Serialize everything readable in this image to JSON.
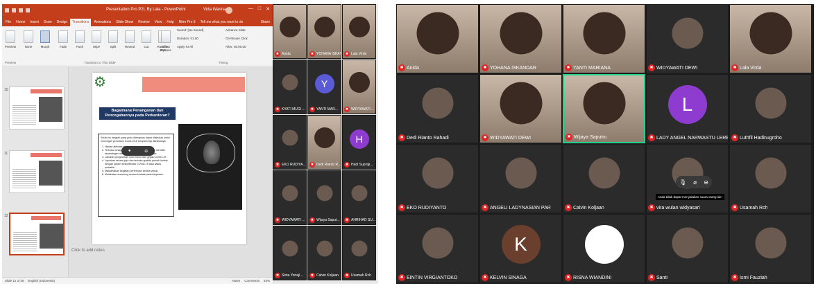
{
  "ppt": {
    "title": "Presentation Pro P2L By Lala - PowerPoint",
    "user": "Vida Wanna",
    "window_buttons": [
      "—",
      "□",
      "✕"
    ],
    "tabs": [
      "File",
      "Home",
      "Insert",
      "Draw",
      "Design",
      "Transitions",
      "Animations",
      "Slide Show",
      "Review",
      "View",
      "Help",
      "Nitro Pro 9",
      "Tell me what you want to do"
    ],
    "active_tab": "Transitions",
    "share": "Share",
    "ribbon_buttons": [
      "Preview",
      "None",
      "Morph",
      "Fade",
      "Push",
      "Wipe",
      "Split",
      "Reveal",
      "Cut",
      "Random Bars",
      "Effect Options"
    ],
    "timing": {
      "sound": "Sound: [No Sound]",
      "duration": "Duration: 01.00",
      "apply": "Apply To All",
      "advance": "Advance Slide",
      "on_click": "On Mouse Click",
      "after": "After: 00:00.00"
    },
    "groups": {
      "preview": "Preview",
      "transition": "Transition to This Slide",
      "timing": "Timing"
    },
    "slide_numbers": [
      "10",
      "11",
      "12"
    ],
    "slide": {
      "title": "Bagaimana Penanganan dan Pencegahannya pada Perkantoran?",
      "intro": "Selain itu langkah yang perlu diterapkan dapat dilakukan untuk mencegah penularan Covid-19 di tempat kerja diantaranya:",
      "list": [
        "Hindari aktivitas makan bersama.",
        "Terbuka melapor kepada pihak kantor apabila memiliki kepentingan melakukan perjalanan keluar kota.",
        "Lakukan pengecekan suhu tubuh dan gejala COVID-19.",
        "Laporkan secara jujur dan terbuka apabila pernah kontak dengan pasien terkonfirmasi COVID-19 atau kasus probable.",
        "Maksimalkan kegiatan pertemuan secara virtual.",
        "Melakukan screening secara berkala pada karyawan."
      ]
    },
    "notes": "Click to add notes",
    "status": {
      "slide": "Slide 12 of 26",
      "language": "English (Indonesia)",
      "notes": "Notes",
      "comments": "Comments",
      "zoom": "53%"
    }
  },
  "left_tiles": [
    {
      "name": "Anida",
      "avatar": "",
      "color": "",
      "video": true
    },
    {
      "name": "YOHANA ISKANDAR",
      "avatar": "",
      "color": "",
      "video": true
    },
    {
      "name": "Lala Virda",
      "avatar": "",
      "color": "",
      "video": true
    },
    {
      "name": "KYATI MUGI ...",
      "avatar": "",
      "color": "",
      "video": false
    },
    {
      "name": "YANTI MAR...",
      "avatar": "Y",
      "color": "#5b5bd6",
      "video": false
    },
    {
      "name": "WIDYAWATI ...",
      "avatar": "",
      "color": "",
      "video": true
    },
    {
      "name": "EKO RUDIYA...",
      "avatar": "",
      "color": "",
      "video": false
    },
    {
      "name": "Dedi Rianto R...",
      "avatar": "",
      "color": "",
      "video": true
    },
    {
      "name": "Hadi Supraji...",
      "avatar": "H",
      "color": "#8e3bd0",
      "video": false
    },
    {
      "name": "WIDYAWATI ...",
      "avatar": "",
      "color": "",
      "video": false
    },
    {
      "name": "Wijaya Saput...",
      "avatar": "",
      "color": "",
      "video": false
    },
    {
      "name": "AHRIHAD SU...",
      "avatar": "",
      "color": "",
      "video": false
    },
    {
      "name": "Sinta Yortajl...",
      "avatar": "",
      "color": "",
      "video": false
    },
    {
      "name": "Calvin Koljaan",
      "avatar": "",
      "color": "",
      "video": false
    },
    {
      "name": "Usamah Rch",
      "avatar": "",
      "color": "",
      "video": false
    }
  ],
  "right_tiles": [
    {
      "name": "Anida",
      "avatar": "",
      "color": "",
      "video": true
    },
    {
      "name": "YOHANA ISKANDAR",
      "avatar": "",
      "color": "",
      "video": true
    },
    {
      "name": "YANTI MARIANA",
      "avatar": "",
      "color": "",
      "video": true
    },
    {
      "name": "WIDYAWATI DEWI",
      "avatar": "",
      "color": "",
      "video": false
    },
    {
      "name": "Lala Virda",
      "avatar": "",
      "color": "",
      "video": true
    },
    {
      "name": "Dedi Rianto Rahadi",
      "avatar": "",
      "color": "",
      "video": false
    },
    {
      "name": "WIDYAWATI DEWI",
      "avatar": "",
      "color": "",
      "video": true
    },
    {
      "name": "Wijaya Saputro",
      "avatar": "",
      "color": "",
      "video": true
    },
    {
      "name": "LADY ANGEL NARWASTU LEREBULAN",
      "avatar": "L",
      "color": "#8e3bd0",
      "video": false
    },
    {
      "name": "Luthfil Hadinugroho",
      "avatar": "",
      "color": "",
      "video": false
    },
    {
      "name": "EKO RUDIYANTO",
      "avatar": "",
      "color": "",
      "video": false
    },
    {
      "name": "ANGELI LADYNASIAN PAR",
      "avatar": "",
      "color": "",
      "video": false
    },
    {
      "name": "Calvin Koljaan",
      "avatar": "",
      "color": "",
      "video": false
    },
    {
      "name": "vira wulan widyasari",
      "avatar": "",
      "color": "",
      "video": false
    },
    {
      "name": "Usamah Rch",
      "avatar": "",
      "color": "",
      "video": false
    },
    {
      "name": "EINTIN VIRGIANTOKO",
      "avatar": "",
      "color": "",
      "video": false
    },
    {
      "name": "KELVIN SINAGA",
      "avatar": "K",
      "color": "#6b3f2e",
      "video": false
    },
    {
      "name": "RISNA WIANDINI",
      "avatar": "",
      "color": "#ffffff",
      "video": false
    },
    {
      "name": "Santi",
      "avatar": "",
      "color": "",
      "video": false
    },
    {
      "name": "Ismi Fauziah",
      "avatar": "",
      "color": "",
      "video": false
    }
  ],
  "hover_tooltip": "Anda tidak dapat menyalakan suara orang lain",
  "mic_icon": "microphone-muted-icon"
}
